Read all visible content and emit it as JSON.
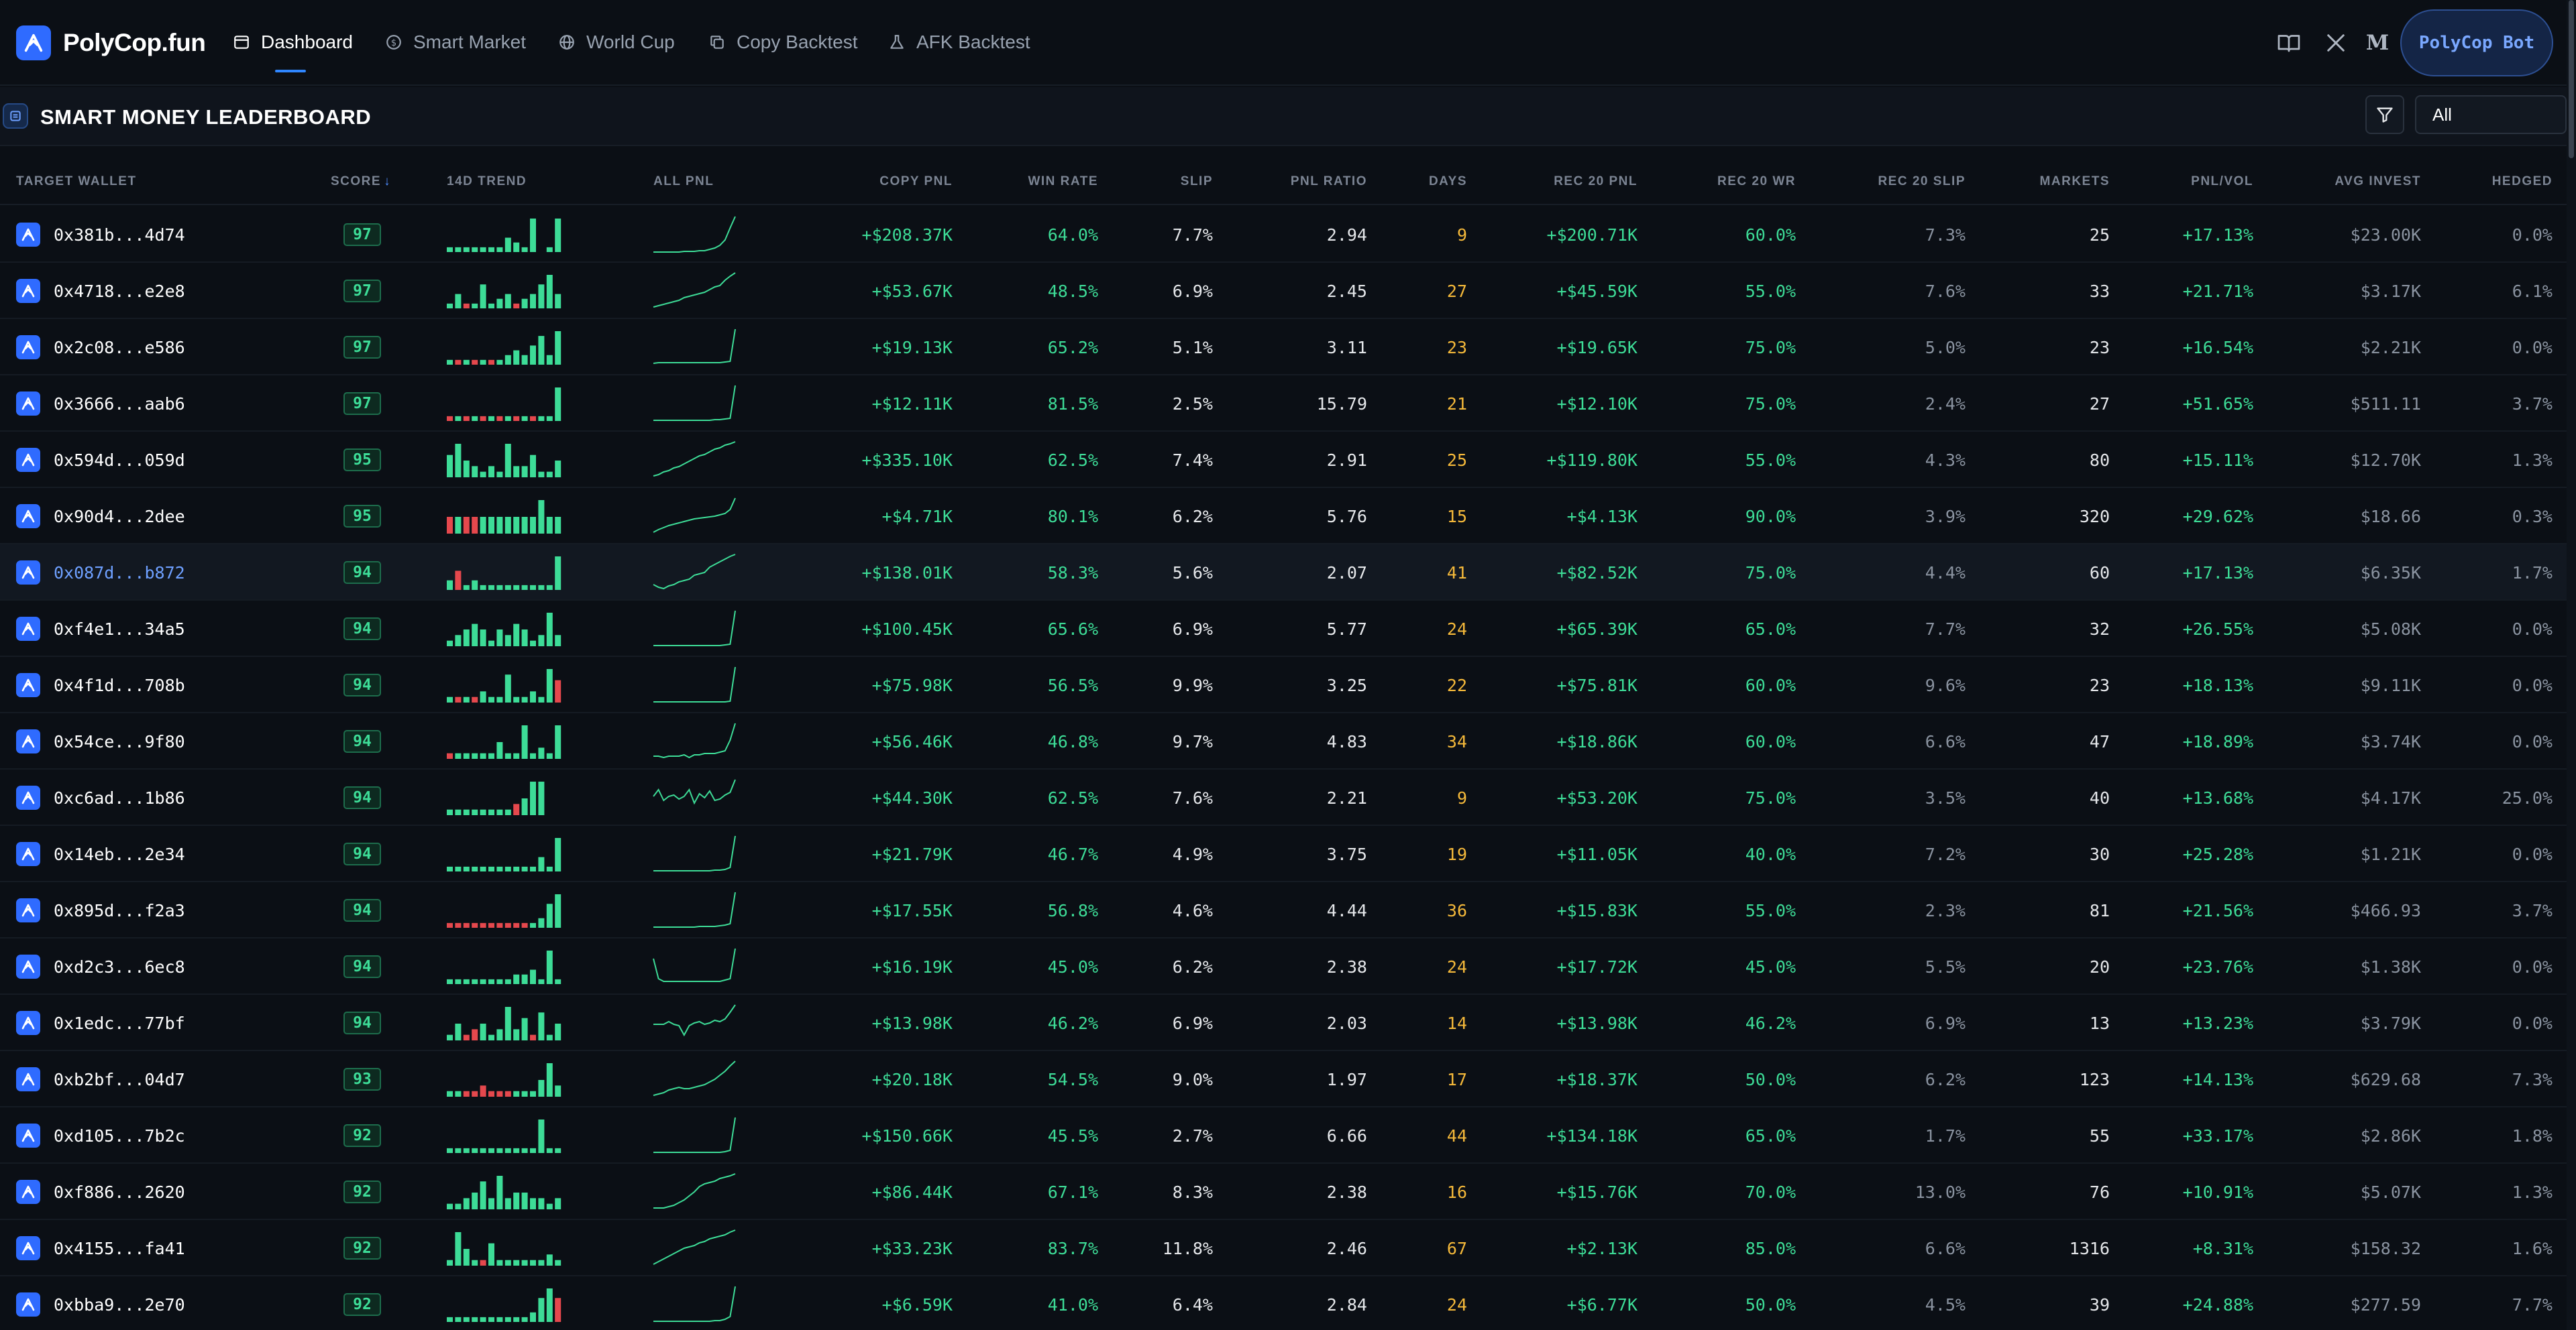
{
  "nav": {
    "brand": "PolyCop.fun",
    "tabs": [
      {
        "label": "Dashboard",
        "icon": "dashboard-icon",
        "active": true
      },
      {
        "label": "Smart Market",
        "icon": "dollar-circle-icon",
        "active": false
      },
      {
        "label": "World Cup",
        "icon": "globe-icon",
        "active": false
      },
      {
        "label": "Copy Backtest",
        "icon": "copy-icon",
        "active": false
      },
      {
        "label": "AFK Backtest",
        "icon": "flask-icon",
        "active": false
      }
    ],
    "right_icons": [
      "book-icon",
      "x-logo-icon",
      "medium-logo-icon"
    ],
    "bot_button": "PolyCop Bot"
  },
  "section": {
    "title": "SMART MONEY LEADERBOARD",
    "filter_value": "All"
  },
  "columns": [
    "TARGET WALLET",
    "SCORE",
    "14D TREND",
    "ALL PNL",
    "COPY PNL",
    "WIN RATE",
    "SLIP",
    "PNL RATIO",
    "DAYS",
    "REC 20 PNL",
    "REC 20 WR",
    "REC 20 SLIP",
    "MARKETS",
    "PNL/VOL",
    "AVG INVEST",
    "HEDGED"
  ],
  "colors": {
    "accent": "#2f6bff",
    "positive": "#3ddc97",
    "negative": "#e5484d",
    "days": "#f5b93a",
    "background": "#0b0f15"
  },
  "rows": [
    {
      "wallet": "0x381b...4d74",
      "score": "97",
      "copy_pnl": "+$208.37K",
      "win_rate": "64.0%",
      "slip": "7.7%",
      "pnl_ratio": "2.94",
      "days": "9",
      "rec20_pnl": "+$200.71K",
      "rec20_wr": "60.0%",
      "rec20_slip": "7.3%",
      "markets": "25",
      "pnl_vol": "+17.13%",
      "avg_invest": "$23.00K",
      "hedged": "0.0%",
      "trend": [
        1,
        1,
        1,
        1,
        1,
        1,
        1,
        3,
        2,
        1,
        7,
        0,
        1,
        7
      ],
      "trend_neg": [],
      "pnl": [
        2,
        2,
        2,
        2,
        2,
        2,
        3,
        3,
        3,
        4,
        4,
        6,
        8,
        12,
        20,
        38,
        55
      ]
    },
    {
      "wallet": "0x4718...e2e8",
      "score": "97",
      "copy_pnl": "+$53.67K",
      "win_rate": "48.5%",
      "slip": "6.9%",
      "pnl_ratio": "2.45",
      "days": "27",
      "rec20_pnl": "+$45.59K",
      "rec20_wr": "55.0%",
      "rec20_slip": "7.6%",
      "markets": "33",
      "pnl_vol": "+21.71%",
      "avg_invest": "$3.17K",
      "hedged": "6.1%",
      "trend": [
        1,
        3,
        1,
        1,
        5,
        1,
        2,
        3,
        1,
        2,
        3,
        5,
        7,
        3
      ],
      "trend_neg": [
        2,
        8
      ],
      "pnl": [
        4,
        6,
        8,
        10,
        12,
        14,
        18,
        20,
        22,
        24,
        26,
        30,
        34,
        36,
        44,
        50,
        55
      ]
    },
    {
      "wallet": "0x2c08...e586",
      "score": "97",
      "copy_pnl": "+$19.13K",
      "win_rate": "65.2%",
      "slip": "5.1%",
      "pnl_ratio": "3.11",
      "days": "23",
      "rec20_pnl": "+$19.65K",
      "rec20_wr": "75.0%",
      "rec20_slip": "5.0%",
      "markets": "23",
      "pnl_vol": "+16.54%",
      "avg_invest": "$2.21K",
      "hedged": "0.0%",
      "trend": [
        1,
        1,
        1,
        1,
        1,
        1,
        1,
        2,
        3,
        2,
        4,
        6,
        2,
        7
      ],
      "trend_neg": [
        1,
        3,
        5
      ],
      "pnl": [
        4,
        5,
        5,
        5,
        5,
        5,
        5,
        5,
        5,
        5,
        5,
        5,
        5,
        5,
        6,
        7,
        55
      ]
    },
    {
      "wallet": "0x3666...aab6",
      "score": "97",
      "copy_pnl": "+$12.11K",
      "win_rate": "81.5%",
      "slip": "2.5%",
      "pnl_ratio": "15.79",
      "days": "21",
      "rec20_pnl": "+$12.10K",
      "rec20_wr": "75.0%",
      "rec20_slip": "2.4%",
      "markets": "27",
      "pnl_vol": "+51.65%",
      "avg_invest": "$511.11",
      "hedged": "3.7%",
      "trend": [
        1,
        1,
        1,
        1,
        1,
        1,
        1,
        1,
        1,
        1,
        1,
        1,
        1,
        7
      ],
      "trend_neg": [
        0,
        2,
        4,
        6,
        8,
        10
      ],
      "pnl": [
        3,
        3,
        3,
        3,
        3,
        3,
        3,
        3,
        3,
        3,
        3,
        3,
        4,
        4,
        5,
        6,
        55
      ]
    },
    {
      "wallet": "0x594d...059d",
      "score": "95",
      "copy_pnl": "+$335.10K",
      "win_rate": "62.5%",
      "slip": "7.4%",
      "pnl_ratio": "2.91",
      "days": "25",
      "rec20_pnl": "+$119.80K",
      "rec20_wr": "55.0%",
      "rec20_slip": "4.3%",
      "markets": "80",
      "pnl_vol": "+15.11%",
      "avg_invest": "$12.70K",
      "hedged": "1.3%",
      "trend": [
        4,
        6,
        3,
        2,
        1,
        2,
        1,
        6,
        2,
        2,
        4,
        1,
        1,
        3
      ],
      "trend_neg": [],
      "pnl": [
        4,
        6,
        10,
        12,
        16,
        18,
        22,
        26,
        30,
        34,
        36,
        40,
        44,
        46,
        50,
        52,
        55
      ]
    },
    {
      "wallet": "0x90d4...2dee",
      "score": "95",
      "copy_pnl": "+$4.71K",
      "win_rate": "80.1%",
      "slip": "6.2%",
      "pnl_ratio": "5.76",
      "days": "15",
      "rec20_pnl": "+$4.13K",
      "rec20_wr": "90.0%",
      "rec20_slip": "3.9%",
      "markets": "320",
      "pnl_vol": "+29.62%",
      "avg_invest": "$18.66",
      "hedged": "0.3%",
      "trend": [
        1,
        1,
        1,
        1,
        1,
        1,
        1,
        1,
        1,
        1,
        1,
        2,
        1,
        1
      ],
      "trend_neg": [
        0,
        2,
        3
      ],
      "pnl": [
        4,
        8,
        11,
        14,
        16,
        18,
        20,
        22,
        24,
        25,
        26,
        27,
        28,
        30,
        32,
        38,
        55
      ]
    },
    {
      "wallet": "0x087d...b872",
      "score": "94",
      "copy_pnl": "+$138.01K",
      "win_rate": "58.3%",
      "slip": "5.6%",
      "pnl_ratio": "2.07",
      "days": "41",
      "rec20_pnl": "+$82.52K",
      "rec20_wr": "75.0%",
      "rec20_slip": "4.4%",
      "markets": "60",
      "pnl_vol": "+17.13%",
      "avg_invest": "$6.35K",
      "hedged": "1.7%",
      "highlight": true,
      "trend": [
        2,
        4,
        1,
        2,
        1,
        1,
        1,
        1,
        1,
        1,
        1,
        1,
        1,
        7
      ],
      "trend_neg": [
        1
      ],
      "pnl": [
        10,
        6,
        4,
        8,
        10,
        14,
        16,
        18,
        24,
        26,
        28,
        36,
        40,
        44,
        48,
        52,
        55
      ]
    },
    {
      "wallet": "0xf4e1...34a5",
      "score": "94",
      "copy_pnl": "+$100.45K",
      "win_rate": "65.6%",
      "slip": "6.9%",
      "pnl_ratio": "5.77",
      "days": "24",
      "rec20_pnl": "+$65.39K",
      "rec20_wr": "65.0%",
      "rec20_slip": "7.7%",
      "markets": "32",
      "pnl_vol": "+26.55%",
      "avg_invest": "$5.08K",
      "hedged": "0.0%",
      "trend": [
        1,
        2,
        3,
        4,
        3,
        1,
        3,
        2,
        4,
        3,
        1,
        2,
        6,
        2
      ],
      "trend_neg": [],
      "pnl": [
        3,
        3,
        3,
        3,
        3,
        3,
        3,
        3,
        3,
        3,
        3,
        3,
        3,
        3,
        4,
        5,
        55
      ]
    },
    {
      "wallet": "0x4f1d...708b",
      "score": "94",
      "copy_pnl": "+$75.98K",
      "win_rate": "56.5%",
      "slip": "9.9%",
      "pnl_ratio": "3.25",
      "days": "22",
      "rec20_pnl": "+$75.81K",
      "rec20_wr": "60.0%",
      "rec20_slip": "9.6%",
      "markets": "23",
      "pnl_vol": "+18.13%",
      "avg_invest": "$9.11K",
      "hedged": "0.0%",
      "trend": [
        1,
        1,
        1,
        1,
        2,
        1,
        1,
        5,
        1,
        1,
        2,
        1,
        6,
        4
      ],
      "trend_neg": [
        1,
        3,
        13
      ],
      "pnl": [
        3,
        3,
        3,
        3,
        3,
        3,
        3,
        3,
        3,
        3,
        3,
        3,
        3,
        3,
        3,
        4,
        55
      ]
    },
    {
      "wallet": "0x54ce...9f80",
      "score": "94",
      "copy_pnl": "+$56.46K",
      "win_rate": "46.8%",
      "slip": "9.7%",
      "pnl_ratio": "4.83",
      "days": "34",
      "rec20_pnl": "+$18.86K",
      "rec20_wr": "60.0%",
      "rec20_slip": "6.6%",
      "markets": "47",
      "pnl_vol": "+18.89%",
      "avg_invest": "$3.74K",
      "hedged": "0.0%",
      "trend": [
        1,
        1,
        1,
        1,
        1,
        1,
        3,
        1,
        1,
        6,
        1,
        2,
        1,
        6
      ],
      "trend_neg": [
        0
      ],
      "pnl": [
        6,
        6,
        4,
        6,
        6,
        6,
        8,
        4,
        8,
        8,
        10,
        10,
        10,
        12,
        14,
        30,
        55
      ]
    },
    {
      "wallet": "0xc6ad...1b86",
      "score": "94",
      "copy_pnl": "+$44.30K",
      "win_rate": "62.5%",
      "slip": "7.6%",
      "pnl_ratio": "2.21",
      "days": "9",
      "rec20_pnl": "+$53.20K",
      "rec20_wr": "75.0%",
      "rec20_slip": "3.5%",
      "markets": "40",
      "pnl_vol": "+13.68%",
      "avg_invest": "$4.17K",
      "hedged": "25.0%",
      "trend": [
        1,
        1,
        1,
        1,
        1,
        1,
        1,
        1,
        2,
        3,
        6,
        6,
        0,
        0
      ],
      "trend_neg": [
        8
      ],
      "pnl": [
        30,
        40,
        24,
        30,
        32,
        26,
        30,
        40,
        20,
        34,
        28,
        38,
        24,
        26,
        32,
        36,
        55
      ]
    },
    {
      "wallet": "0x14eb...2e34",
      "score": "94",
      "copy_pnl": "+$21.79K",
      "win_rate": "46.7%",
      "slip": "4.9%",
      "pnl_ratio": "3.75",
      "days": "19",
      "rec20_pnl": "+$11.05K",
      "rec20_wr": "40.0%",
      "rec20_slip": "7.2%",
      "markets": "30",
      "pnl_vol": "+25.28%",
      "avg_invest": "$1.21K",
      "hedged": "0.0%",
      "trend": [
        1,
        1,
        1,
        1,
        1,
        1,
        1,
        1,
        1,
        1,
        1,
        3,
        1,
        7
      ],
      "trend_neg": [],
      "pnl": [
        3,
        3,
        3,
        3,
        3,
        3,
        3,
        3,
        3,
        3,
        3,
        3,
        4,
        4,
        5,
        8,
        55
      ]
    },
    {
      "wallet": "0x895d...f2a3",
      "score": "94",
      "copy_pnl": "+$17.55K",
      "win_rate": "56.8%",
      "slip": "4.6%",
      "pnl_ratio": "4.44",
      "days": "36",
      "rec20_pnl": "+$15.83K",
      "rec20_wr": "55.0%",
      "rec20_slip": "2.3%",
      "markets": "81",
      "pnl_vol": "+21.56%",
      "avg_invest": "$466.93",
      "hedged": "3.7%",
      "trend": [
        1,
        1,
        1,
        1,
        1,
        1,
        1,
        1,
        1,
        1,
        1,
        2,
        5,
        7
      ],
      "trend_neg": [
        0,
        1,
        2,
        3,
        4,
        5,
        6,
        7,
        8,
        9
      ],
      "pnl": [
        3,
        3,
        3,
        3,
        3,
        3,
        3,
        3,
        3,
        4,
        4,
        4,
        4,
        5,
        6,
        8,
        55
      ]
    },
    {
      "wallet": "0xd2c3...6ec8",
      "score": "94",
      "copy_pnl": "+$16.19K",
      "win_rate": "45.0%",
      "slip": "6.2%",
      "pnl_ratio": "2.38",
      "days": "24",
      "rec20_pnl": "+$17.72K",
      "rec20_wr": "45.0%",
      "rec20_slip": "5.5%",
      "markets": "20",
      "pnl_vol": "+23.76%",
      "avg_invest": "$1.38K",
      "hedged": "0.0%",
      "trend": [
        1,
        1,
        1,
        1,
        1,
        1,
        1,
        1,
        2,
        2,
        3,
        1,
        7,
        1
      ],
      "trend_neg": [],
      "pnl": [
        40,
        10,
        6,
        6,
        6,
        6,
        6,
        6,
        6,
        6,
        6,
        6,
        6,
        6,
        8,
        10,
        55
      ]
    },
    {
      "wallet": "0x1edc...77bf",
      "score": "94",
      "copy_pnl": "+$13.98K",
      "win_rate": "46.2%",
      "slip": "6.9%",
      "pnl_ratio": "2.03",
      "days": "14",
      "rec20_pnl": "+$13.98K",
      "rec20_wr": "46.2%",
      "rec20_slip": "6.9%",
      "markets": "13",
      "pnl_vol": "+13.23%",
      "avg_invest": "$3.79K",
      "hedged": "0.0%",
      "trend": [
        1,
        3,
        1,
        2,
        3,
        1,
        2,
        6,
        2,
        4,
        1,
        5,
        1,
        3
      ],
      "trend_neg": [
        2,
        3,
        10
      ],
      "pnl": [
        26,
        26,
        26,
        30,
        26,
        24,
        10,
        24,
        28,
        30,
        26,
        28,
        32,
        30,
        34,
        44,
        55
      ]
    },
    {
      "wallet": "0xb2bf...04d7",
      "score": "93",
      "copy_pnl": "+$20.18K",
      "win_rate": "54.5%",
      "slip": "9.0%",
      "pnl_ratio": "1.97",
      "days": "17",
      "rec20_pnl": "+$18.37K",
      "rec20_wr": "50.0%",
      "rec20_slip": "6.2%",
      "markets": "123",
      "pnl_vol": "+14.13%",
      "avg_invest": "$629.68",
      "hedged": "7.3%",
      "trend": [
        1,
        1,
        1,
        1,
        2,
        1,
        1,
        1,
        1,
        1,
        1,
        3,
        6,
        2
      ],
      "trend_neg": [
        2,
        3,
        4,
        5,
        6,
        7
      ],
      "pnl": [
        4,
        6,
        8,
        12,
        14,
        16,
        14,
        14,
        16,
        18,
        20,
        24,
        28,
        34,
        40,
        48,
        55
      ]
    },
    {
      "wallet": "0xd105...7b2c",
      "score": "92",
      "copy_pnl": "+$150.66K",
      "win_rate": "45.5%",
      "slip": "2.7%",
      "pnl_ratio": "6.66",
      "days": "44",
      "rec20_pnl": "+$134.18K",
      "rec20_wr": "65.0%",
      "rec20_slip": "1.7%",
      "markets": "55",
      "pnl_vol": "+33.17%",
      "avg_invest": "$2.86K",
      "hedged": "1.8%",
      "trend": [
        1,
        1,
        1,
        1,
        1,
        1,
        1,
        1,
        1,
        1,
        1,
        7,
        1,
        1
      ],
      "trend_neg": [],
      "pnl": [
        3,
        3,
        3,
        3,
        3,
        3,
        3,
        3,
        3,
        3,
        3,
        3,
        3,
        3,
        4,
        6,
        55
      ]
    },
    {
      "wallet": "0xf886...2620",
      "score": "92",
      "copy_pnl": "+$86.44K",
      "win_rate": "67.1%",
      "slip": "8.3%",
      "pnl_ratio": "2.38",
      "days": "16",
      "rec20_pnl": "+$15.76K",
      "rec20_wr": "70.0%",
      "rec20_slip": "13.0%",
      "markets": "76",
      "pnl_vol": "+10.91%",
      "avg_invest": "$5.07K",
      "hedged": "1.3%",
      "trend": [
        1,
        1,
        2,
        3,
        5,
        2,
        6,
        2,
        3,
        3,
        2,
        2,
        1,
        2
      ],
      "trend_neg": [],
      "pnl": [
        4,
        4,
        4,
        6,
        8,
        12,
        16,
        22,
        28,
        36,
        40,
        42,
        44,
        48,
        50,
        52,
        55
      ]
    },
    {
      "wallet": "0x4155...fa41",
      "score": "92",
      "copy_pnl": "+$33.23K",
      "win_rate": "83.7%",
      "slip": "11.8%",
      "pnl_ratio": "2.46",
      "days": "67",
      "rec20_pnl": "+$2.13K",
      "rec20_wr": "85.0%",
      "rec20_slip": "6.6%",
      "markets": "1316",
      "pnl_vol": "+8.31%",
      "avg_invest": "$158.32",
      "hedged": "1.6%",
      "trend": [
        1,
        6,
        3,
        1,
        1,
        4,
        1,
        1,
        1,
        1,
        1,
        1,
        2,
        1
      ],
      "trend_neg": [
        4
      ],
      "pnl": [
        4,
        8,
        12,
        16,
        20,
        24,
        28,
        30,
        32,
        36,
        38,
        42,
        44,
        46,
        48,
        52,
        55
      ]
    },
    {
      "wallet": "0xbba9...2e70",
      "score": "92",
      "copy_pnl": "+$6.59K",
      "win_rate": "41.0%",
      "slip": "6.4%",
      "pnl_ratio": "2.84",
      "days": "24",
      "rec20_pnl": "+$6.77K",
      "rec20_wr": "50.0%",
      "rec20_slip": "4.5%",
      "markets": "39",
      "pnl_vol": "+24.88%",
      "avg_invest": "$277.59",
      "hedged": "7.7%",
      "trend": [
        1,
        1,
        1,
        1,
        1,
        1,
        1,
        1,
        1,
        1,
        2,
        5,
        7,
        5
      ],
      "trend_neg": [
        13
      ],
      "pnl": [
        3,
        3,
        3,
        3,
        3,
        3,
        3,
        3,
        3,
        3,
        3,
        3,
        4,
        4,
        6,
        10,
        55
      ]
    }
  ]
}
